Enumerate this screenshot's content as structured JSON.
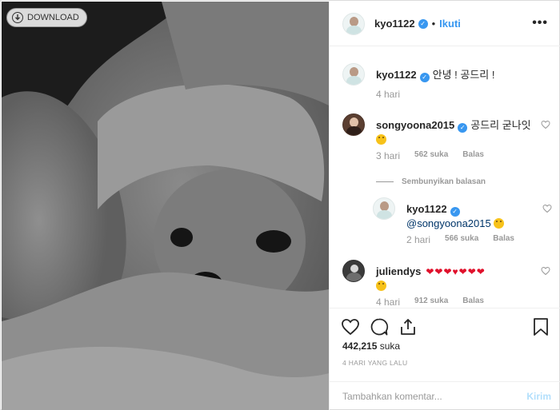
{
  "photo": {
    "download_label": "DOWNLOAD",
    "icon": "download-icon"
  },
  "header": {
    "username": "kyo1122",
    "separator": "•",
    "follow_label": "Ikuti",
    "more_icon": "more-options-icon",
    "more_label": "•••"
  },
  "comments": [
    {
      "username": "kyo1122",
      "text": "안녕 ! 공드리 !",
      "time": "4 hari"
    },
    {
      "username": "songyoona2015",
      "text": "공드리 굳나잇",
      "time": "3 hari",
      "likes": "562 suka",
      "reply_label": "Balas",
      "hide_replies_label": "Sembunyikan balasan"
    },
    {
      "username": "kyo1122",
      "mention": "@songyoona2015",
      "time": "2 hari",
      "likes": "566 suka",
      "reply_label": "Balas"
    },
    {
      "username": "juliendys",
      "time": "4 hari",
      "likes": "912 suka",
      "reply_label": "Balas"
    }
  ],
  "actions": {
    "like_icon": "heart-icon",
    "comment_icon": "comment-icon",
    "share_icon": "share-icon",
    "save_icon": "bookmark-icon",
    "likes_count": "442,215",
    "likes_suffix": "suka",
    "timestamp": "4 HARI YANG LALU"
  },
  "add_comment": {
    "placeholder": "Tambahkan komentar...",
    "post_label": "Kirim"
  },
  "colors": {
    "accent": "#3897f0",
    "heart_red": "#e0102b",
    "muted": "#999999",
    "post_disabled": "#b2dffc"
  }
}
